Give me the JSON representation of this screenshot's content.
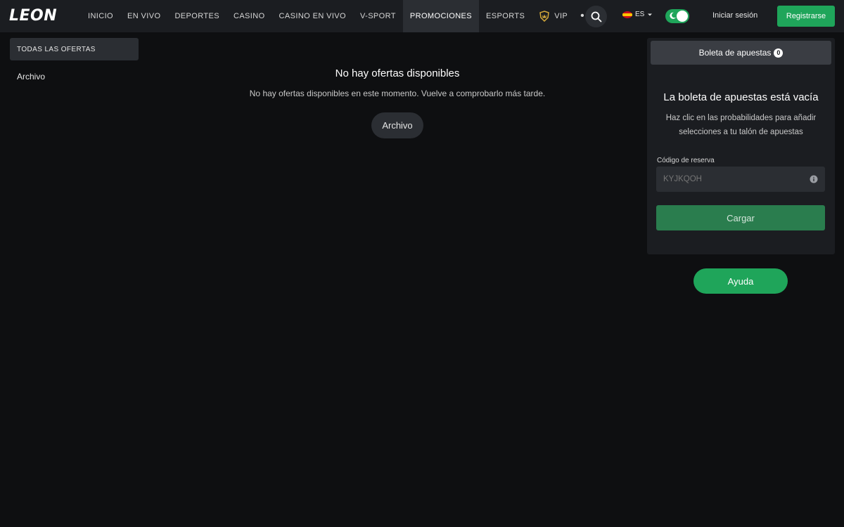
{
  "header": {
    "logo": "LEON",
    "nav": [
      {
        "label": "INICIO",
        "active": false
      },
      {
        "label": "EN VIVO",
        "active": false
      },
      {
        "label": "DEPORTES",
        "active": false
      },
      {
        "label": "CASINO",
        "active": false
      },
      {
        "label": "CASINO EN VIVO",
        "active": false
      },
      {
        "label": "V-SPORT",
        "active": false
      },
      {
        "label": "PROMOCIONES",
        "active": true
      },
      {
        "label": "ESPORTS",
        "active": false
      },
      {
        "label": "VIP",
        "active": false,
        "icon": "crown-shield-icon"
      }
    ],
    "more_label": "•••",
    "language": "ES",
    "login_label": "Iniciar sesión",
    "register_label": "Registrarse"
  },
  "sidebar": {
    "items": [
      {
        "label": "TODAS LAS OFERTAS",
        "active": true
      },
      {
        "label": "Archivo",
        "active": false
      }
    ]
  },
  "main": {
    "title": "No hay ofertas disponibles",
    "subtitle": "No hay ofertas disponibles en este momento. Vuelve a comprobarlo más tarde.",
    "archive_button": "Archivo"
  },
  "betslip": {
    "tab_label": "Boleta de apuestas",
    "count": "0",
    "empty_title": "La boleta de apuestas está vacía",
    "empty_desc": "Haz clic en las probabilidades para añadir selecciones a tu talón de apuestas",
    "code_label": "Código de reserva",
    "code_placeholder": "KYJKQOH",
    "load_button": "Cargar"
  },
  "help_button": "Ayuda",
  "colors": {
    "background": "#0e0f11",
    "header": "#1b1d21",
    "accent_green": "#1fa55a",
    "muted_green": "#2a7d4e",
    "surface": "#2b2e33"
  }
}
